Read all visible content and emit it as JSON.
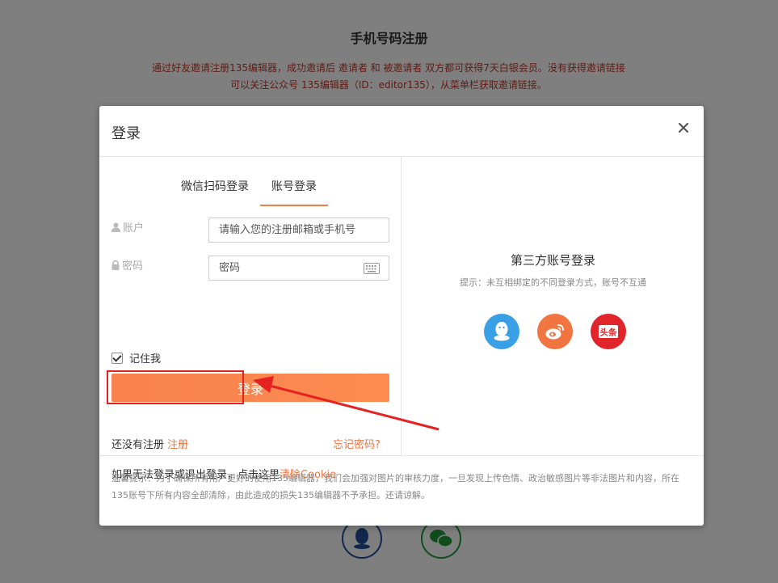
{
  "background": {
    "title": "手机号码注册",
    "notice_line1": "通过好友邀请注册135编辑器，成功邀请后 邀请者 和 被邀请者 双方都可获得7天白银会员。没有获得邀请链接",
    "notice_line2": "可以关注公众号 135编辑器（ID：editor135），从菜单栏获取邀请链接。"
  },
  "modal": {
    "title": "登录",
    "close_icon": "close-icon",
    "tabs": [
      {
        "label": "微信扫码登录",
        "active": false
      },
      {
        "label": "账号登录",
        "active": true
      }
    ],
    "account": {
      "label": "账户",
      "icon": "user-icon",
      "placeholder": "请输入您的注册邮箱或手机号",
      "value": ""
    },
    "password": {
      "label": "密码",
      "icon": "lock-icon",
      "placeholder": "密码",
      "value": "",
      "keyboard_icon": "keyboard-icon"
    },
    "remember_label": "记住我",
    "remember_checked": true,
    "login_button": "登录",
    "no_account_text": "还没有注册",
    "register_link": "注册",
    "forgot_link": "忘记密码?",
    "cookie_text": "如果无法登录或退出登录，点击这里",
    "cookie_link": "清除Cookie",
    "third_party": {
      "title": "第三方账号登录",
      "hint": "提示：未互相绑定的不同登录方式，账号不互通",
      "providers": [
        {
          "name": "qq-icon",
          "color": "#3aa0e6"
        },
        {
          "name": "weibo-icon",
          "color": "#f07541"
        },
        {
          "name": "toutiao-icon",
          "color": "#e0252b",
          "text": "头条"
        }
      ]
    },
    "footer_text": "温馨提示：为了确保所有用户更好的使用135编辑器，我们会加强对图片的审核力度，一旦发现上传色情、政治敏感图片等非法图片和内容，所在135账号下所有内容全部清除，由此造成的损失135编辑器不予承担。还请谅解。"
  },
  "colors": {
    "accent": "#f07541",
    "annotation": "#e52222"
  }
}
